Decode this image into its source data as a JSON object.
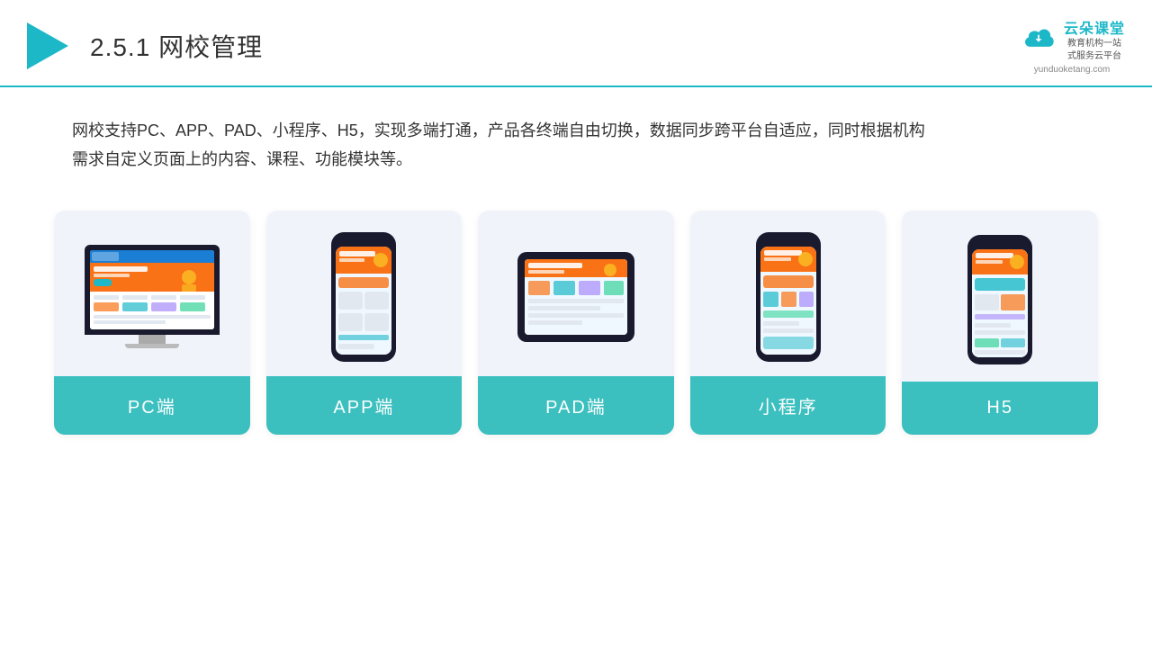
{
  "header": {
    "title_number": "2.5.1",
    "title_main": "网校管理",
    "logo_text": "云朵课堂",
    "logo_url": "yunduoketang.com",
    "logo_tagline_line1": "教育机构一站",
    "logo_tagline_line2": "式服务云平台"
  },
  "description": {
    "text_line1": "网校支持PC、APP、PAD、小程序、H5，实现多端打通，产品各终端自由切换，数据同步跨平台自适应，同时根据机构",
    "text_line2": "需求自定义页面上的内容、课程、功能模块等。"
  },
  "devices": [
    {
      "id": "pc",
      "label": "PC端",
      "type": "pc"
    },
    {
      "id": "app",
      "label": "APP端",
      "type": "phone"
    },
    {
      "id": "pad",
      "label": "PAD端",
      "type": "tablet"
    },
    {
      "id": "miniprogram",
      "label": "小程序",
      "type": "phone"
    },
    {
      "id": "h5",
      "label": "H5",
      "type": "phone"
    }
  ],
  "colors": {
    "accent": "#1cb8c8",
    "card_bg": "#eef2f9",
    "label_bg": "#3bbfbf",
    "label_text": "#ffffff",
    "header_border": "#1cb8c8"
  }
}
